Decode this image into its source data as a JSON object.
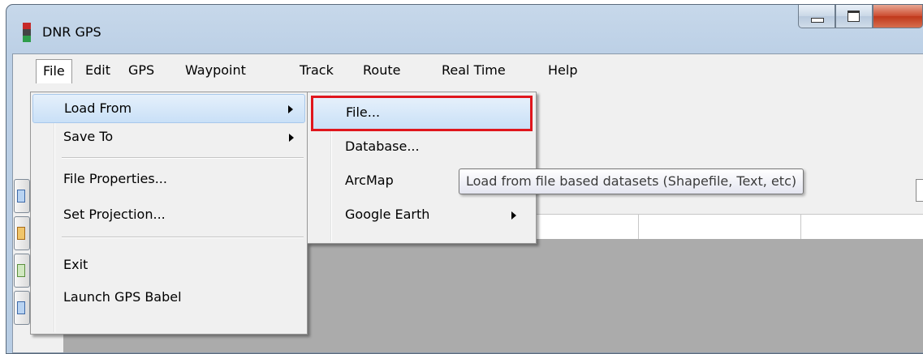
{
  "window": {
    "title": "DNR GPS"
  },
  "menubar": {
    "items": [
      "File",
      "Edit",
      "GPS",
      "Waypoint",
      "Track",
      "Route",
      "Real Time",
      "Help"
    ]
  },
  "file_menu": {
    "load_from": "Load From",
    "save_to": "Save To",
    "file_properties": "File Properties...",
    "set_projection": "Set Projection...",
    "exit": "Exit",
    "launch_gps_babel": "Launch GPS Babel"
  },
  "load_from_submenu": {
    "file": "File...",
    "database": "Database...",
    "arcmap": "ArcMap",
    "google_earth": "Google Earth"
  },
  "tooltip": {
    "text": "Load from file based datasets (Shapefile, Text, etc)"
  },
  "colors": {
    "highlight_border": "#e0161d",
    "title_bar": "#c7d8ea",
    "grid_background": "#ababab"
  }
}
